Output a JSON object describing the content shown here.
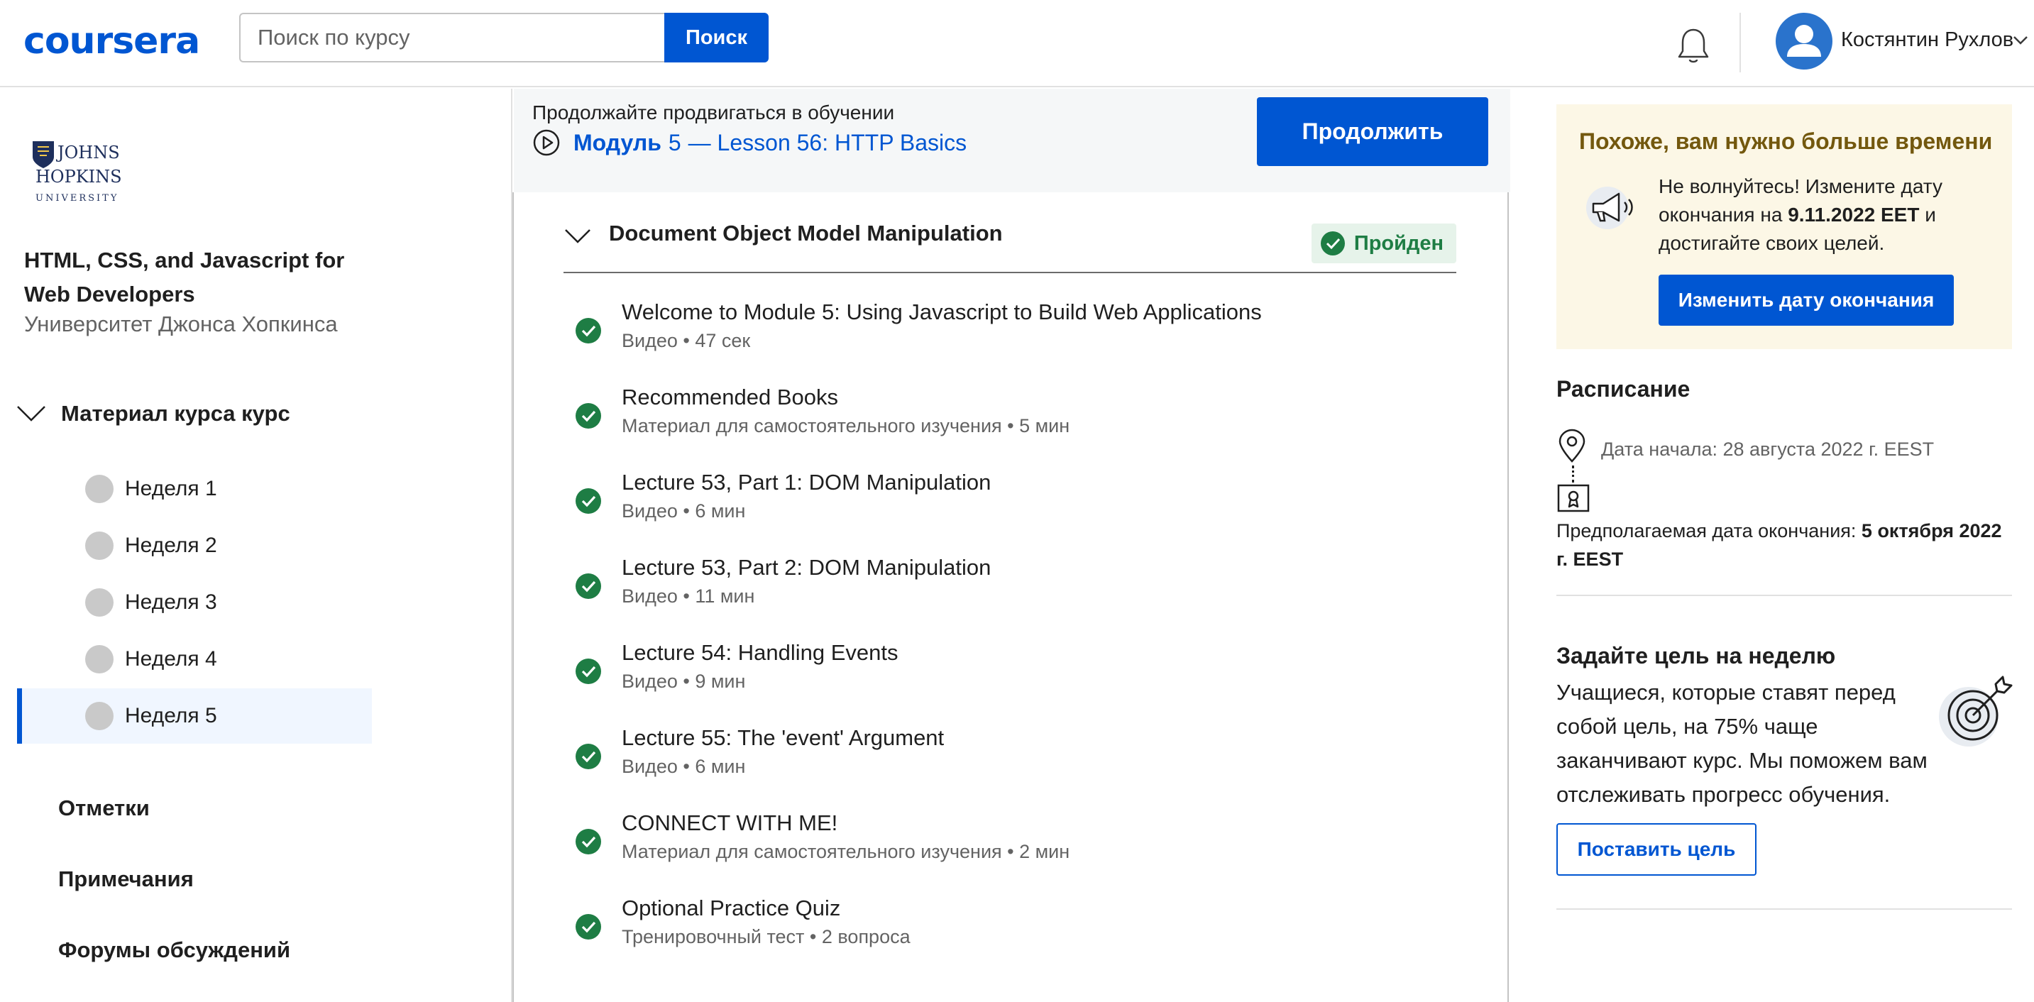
{
  "header": {
    "logo": "coursera",
    "search_placeholder": "Поиск по курсу",
    "search_button": "Поиск",
    "user_name": "Костянтин Рухлов"
  },
  "sidebar": {
    "university_logo_text": "JOHNS HOPKINS UNIVERSITY",
    "course_title": "HTML, CSS, and Javascript for Web Developers",
    "university": "Университет Джонса Хопкинса",
    "material_header": "Материал курса курс",
    "weeks": [
      "Неделя 1",
      "Неделя 2",
      "Неделя 3",
      "Неделя 4",
      "Неделя 5"
    ],
    "active_week": "Неделя 5",
    "links": [
      "Отметки",
      "Примечания",
      "Форумы обсуждений"
    ]
  },
  "resume": {
    "subtitle": "Продолжайте продвигаться в обучении",
    "module_label": "Модуль",
    "module_number": "5",
    "lesson": "— Lesson 56: HTTP Basics",
    "continue_button": "Продолжить"
  },
  "module": {
    "title": "Document Object Model Manipulation",
    "status": "Пройден",
    "items": [
      {
        "title": "Welcome to Module 5: Using Javascript to Build Web Applications",
        "meta": "Видео • 47 сек"
      },
      {
        "title": "Recommended Books",
        "meta": "Материал для самостоятельного изучения • 5 мин"
      },
      {
        "title": "Lecture 53, Part 1: DOM Manipulation",
        "meta": "Видео • 6 мин"
      },
      {
        "title": "Lecture 53, Part 2: DOM Manipulation",
        "meta": "Видео • 11 мин"
      },
      {
        "title": "Lecture 54: Handling Events",
        "meta": "Видео • 9 мин"
      },
      {
        "title": "Lecture 55: The 'event' Argument",
        "meta": "Видео • 6 мин"
      },
      {
        "title": "CONNECT WITH ME!",
        "meta": "Материал для самостоятельного изучения • 2 мин"
      },
      {
        "title": "Optional Practice Quiz",
        "meta": "Тренировочный тест • 2 вопроса"
      }
    ]
  },
  "more_time": {
    "title": "Похоже, вам нужно больше времени",
    "text_before": "Не волнуйтесь! Измените дату окончания на ",
    "date": "9.11.2022 EET",
    "text_after": " и достигайте своих целей.",
    "button": "Изменить дату окончания"
  },
  "schedule": {
    "title": "Расписание",
    "start_date": "Дата начала: 28 августа 2022 г. EEST",
    "end_label": "Предполагаемая дата окончания: ",
    "end_date": "5 октября 2022 г. EEST"
  },
  "goal": {
    "title": "Задайте цель на неделю",
    "text": "Учащиеся, которые ставят перед собой цель, на 75% чаще заканчивают курс. Мы поможем вам отслеживать прогресс обучения.",
    "button": "Поставить цель"
  },
  "colors": {
    "brand": "#0056d2",
    "success": "#1e7d44",
    "warning_bg": "#fcf7e6",
    "warning_title": "#73580e"
  }
}
